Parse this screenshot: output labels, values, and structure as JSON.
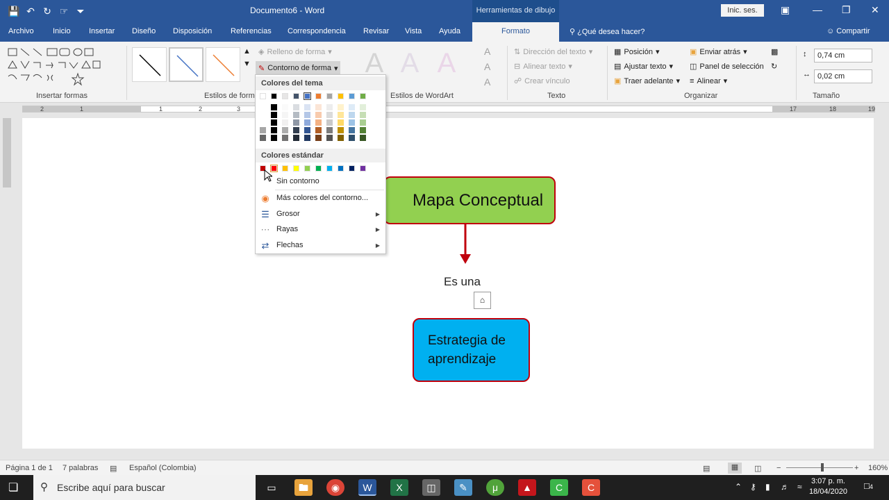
{
  "titlebar": {
    "doc_title": "Documento6 - Word",
    "context_tools": "Herramientas de dibujo",
    "signin": "Inic. ses."
  },
  "tabs": [
    "Archivo",
    "Inicio",
    "Insertar",
    "Diseño",
    "Disposición",
    "Referencias",
    "Correspondencia",
    "Revisar",
    "Vista",
    "Ayuda"
  ],
  "active_tab": "Formato",
  "tell_me": "¿Qué desea hacer?",
  "share": "Compartir",
  "ribbon": {
    "insert_shapes_label": "Insertar formas",
    "shape_styles_label": "Estilos de forma",
    "fill": "Relleno de forma",
    "outline": "Contorno de forma",
    "wordart_label": "Estilos de WordArt",
    "wordart_letter": "A",
    "text_direction": "Dirección del texto",
    "align_text": "Alinear texto",
    "create_link": "Crear vínculo",
    "text_label": "Texto",
    "position": "Posición",
    "wrap_text": "Ajustar texto",
    "bring_forward": "Traer adelante",
    "send_backward": "Enviar atrás",
    "selection_pane": "Panel de selección",
    "align": "Alinear",
    "arrange_label": "Organizar",
    "height": "0,74 cm",
    "width": "0,02 cm",
    "size_label": "Tamaño"
  },
  "dropdown": {
    "theme_colors_header": "Colores del tema",
    "standard_colors_header": "Colores estándar",
    "theme_top": [
      "#ffffff",
      "#000000",
      "#e7e6e6",
      "#44546a",
      "#4472c4",
      "#ed7d31",
      "#a5a5a5",
      "#ffc000",
      "#5b9bd5",
      "#70ad47"
    ],
    "standard": [
      "#c00000",
      "#ff0000",
      "#ffc000",
      "#ffff00",
      "#92d050",
      "#00b050",
      "#00b0f0",
      "#0070c0",
      "#002060",
      "#7030a0"
    ],
    "no_outline": "Sin contorno",
    "more_colors": "Más colores del contorno...",
    "weight": "Grosor",
    "dashes": "Rayas",
    "arrows": "Flechas"
  },
  "document": {
    "title_box": "Mapa Conceptual",
    "connector_label": "Es una",
    "strategy_line1": "Estrategia de",
    "strategy_line2": "aprendizaje"
  },
  "statusbar": {
    "page": "Página 1 de 1",
    "words": "7 palabras",
    "language": "Español (Colombia)",
    "zoom": "160%"
  },
  "taskbar": {
    "search_placeholder": "Escribe aquí para buscar",
    "time": "3:07 p. m.",
    "date": "18/04/2020",
    "notifications": "4"
  }
}
